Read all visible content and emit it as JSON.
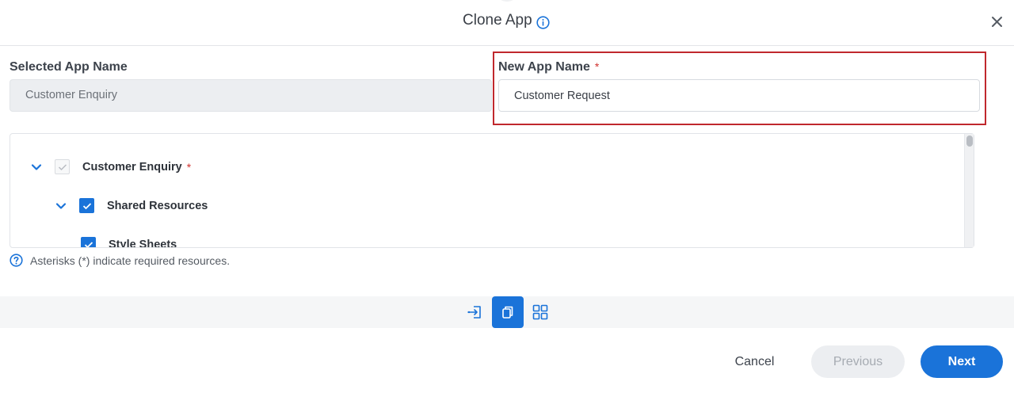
{
  "dialog": {
    "title": "Clone App"
  },
  "form": {
    "selected_label": "Selected App Name",
    "selected_value": "Customer Enquiry",
    "new_label": "New App Name",
    "new_required_mark": "*",
    "new_value": "Customer Request"
  },
  "tree": {
    "items": [
      {
        "label": "Customer Enquiry",
        "required_mark": "*",
        "checked": true,
        "disabled": true,
        "expanded": true
      },
      {
        "label": "Shared Resources",
        "checked": true,
        "expanded": true
      },
      {
        "label": "Style Sheets",
        "checked": true
      }
    ]
  },
  "hint": {
    "text": "Asterisks (*) indicate required resources."
  },
  "steps": {
    "active_index": 1,
    "icons": [
      "import-icon",
      "clone-icon",
      "grid-icon"
    ]
  },
  "footer": {
    "cancel_label": "Cancel",
    "previous_label": "Previous",
    "next_label": "Next"
  },
  "colors": {
    "accent": "#1a73d9",
    "highlight": "#c0282d",
    "required": "#d0312d"
  }
}
